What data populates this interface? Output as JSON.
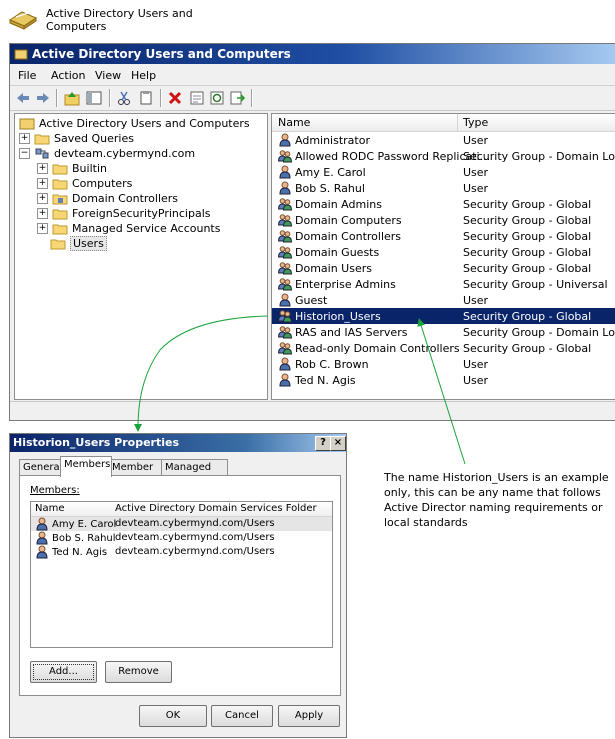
{
  "top_caption": {
    "label": "Active Directory Users and Computers"
  },
  "aduc": {
    "title": "Active Directory Users and Computers",
    "menu": [
      "File",
      "Action",
      "View",
      "Help"
    ],
    "tree": {
      "root": "Active Directory Users and Computers",
      "saved_queries": "Saved Queries",
      "domain": "devteam.cybermynd.com",
      "children": [
        "Builtin",
        "Computers",
        "Domain Controllers",
        "ForeignSecurityPrincipals",
        "Managed Service Accounts",
        "Users"
      ]
    },
    "columns": {
      "name": "Name",
      "type": "Type"
    },
    "rows": [
      {
        "name": "Administrator",
        "type": "User",
        "kind": "user"
      },
      {
        "name": "Allowed RODC Password Replicati...",
        "type": "Security Group - Domain Local",
        "kind": "group"
      },
      {
        "name": "Amy E. Carol",
        "type": "User",
        "kind": "user"
      },
      {
        "name": "Bob S. Rahul",
        "type": "User",
        "kind": "user"
      },
      {
        "name": "Domain Admins",
        "type": "Security Group - Global",
        "kind": "group"
      },
      {
        "name": "Domain Computers",
        "type": "Security Group - Global",
        "kind": "group"
      },
      {
        "name": "Domain Controllers",
        "type": "Security Group - Global",
        "kind": "group"
      },
      {
        "name": "Domain Guests",
        "type": "Security Group - Global",
        "kind": "group"
      },
      {
        "name": "Domain Users",
        "type": "Security Group - Global",
        "kind": "group"
      },
      {
        "name": "Enterprise Admins",
        "type": "Security Group - Universal",
        "kind": "group"
      },
      {
        "name": "Guest",
        "type": "User",
        "kind": "user"
      },
      {
        "name": "Historion_Users",
        "type": "Security Group - Global",
        "kind": "group",
        "selected": true
      },
      {
        "name": "RAS and IAS Servers",
        "type": "Security Group - Domain Local",
        "kind": "group"
      },
      {
        "name": "Read-only Domain Controllers",
        "type": "Security Group - Global",
        "kind": "group"
      },
      {
        "name": "Rob C. Brown",
        "type": "User",
        "kind": "user"
      },
      {
        "name": "Ted N. Agis",
        "type": "User",
        "kind": "user"
      }
    ]
  },
  "props": {
    "title": "Historion_Users Properties",
    "help_btn": "?",
    "close_btn": "×",
    "tabs": [
      "General",
      "Members",
      "Member Of",
      "Managed By"
    ],
    "members_label": "Members:",
    "columns": {
      "name": "Name",
      "folder": "Active Directory Domain Services Folder"
    },
    "members": [
      {
        "name": "Amy E. Carol",
        "folder": "devteam.cybermynd.com/Users"
      },
      {
        "name": "Bob S. Rahul",
        "folder": "devteam.cybermynd.com/Users"
      },
      {
        "name": "Ted N. Agis",
        "folder": "devteam.cybermynd.com/Users"
      }
    ],
    "add_btn": "Add...",
    "remove_btn": "Remove",
    "ok_btn": "OK",
    "cancel_btn": "Cancel",
    "apply_btn": "Apply"
  },
  "annotation": "The name Historion_Users is an example only, this can be any name that follows Active Director naming requirements or local standards",
  "colors": {
    "selection": "#0a246a",
    "arrow": "#1aa33a",
    "titlebar": "#0a246a"
  }
}
